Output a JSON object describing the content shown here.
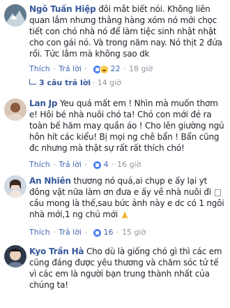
{
  "comments": [
    {
      "name": "Ngô Tuấn Hiệp",
      "text": "đôi mắt biết nói. Không liên quan lắm nhưng thằng hàng xóm nó mới chọc tiết con chó nhà nó để làm tiệc sinh nhật nhật cho con gái nó. Và trong năm nay. Nó thịt 2 đứa rồi. Tức lắm mà không sao dk",
      "like_label": "Thích",
      "reply_label": "Trả lời",
      "reaction_count": "22",
      "time": "18 giờ",
      "replies_label": "3 câu trả lời",
      "replies_time": "14 giờ"
    },
    {
      "name": "Lan Jp",
      "text": "Yeu quá mất em ! Nhìn mà muốn thơm e! Hôi bé nhà nuôi chó ta! Chó con mới đẻ ra toàn bế hăm may quần áo ! Cho lên giường ngủ hôn hít các kiểu! Bị mọi ng chê bẩn ! Bẩn cũng đc nhưng mà thật sự rất rất thích chó!",
      "like_label": "Thích",
      "reply_label": "Trả lời",
      "reaction_count": "4",
      "time": "16 giờ"
    },
    {
      "name": "An Nhiên",
      "text_a": "thương nó quá,ai chụp e ấy lại yt đông vật nữa làm ơn đưa e ấy về nhà nuôi đi",
      "text_b": "cầu mong là thế,sau bức ảnh này e dc có 1 ngôi nhà mới,1 ng chủ mới",
      "like_label": "Thích",
      "reply_label": "Trả lời",
      "reaction_count": "16",
      "time": "15 giờ"
    },
    {
      "name": "Kyo Trần Hà",
      "text": "Cho dù là giống chó gì thì các em cũng đáng được yêu thương và chăm sóc tử tế vì các em là người bạn trung thành nhất của chúng ta!"
    }
  ],
  "colors": {
    "name": "#365899",
    "link": "#4267b2",
    "meta": "#90949c",
    "text": "#1d2129"
  }
}
